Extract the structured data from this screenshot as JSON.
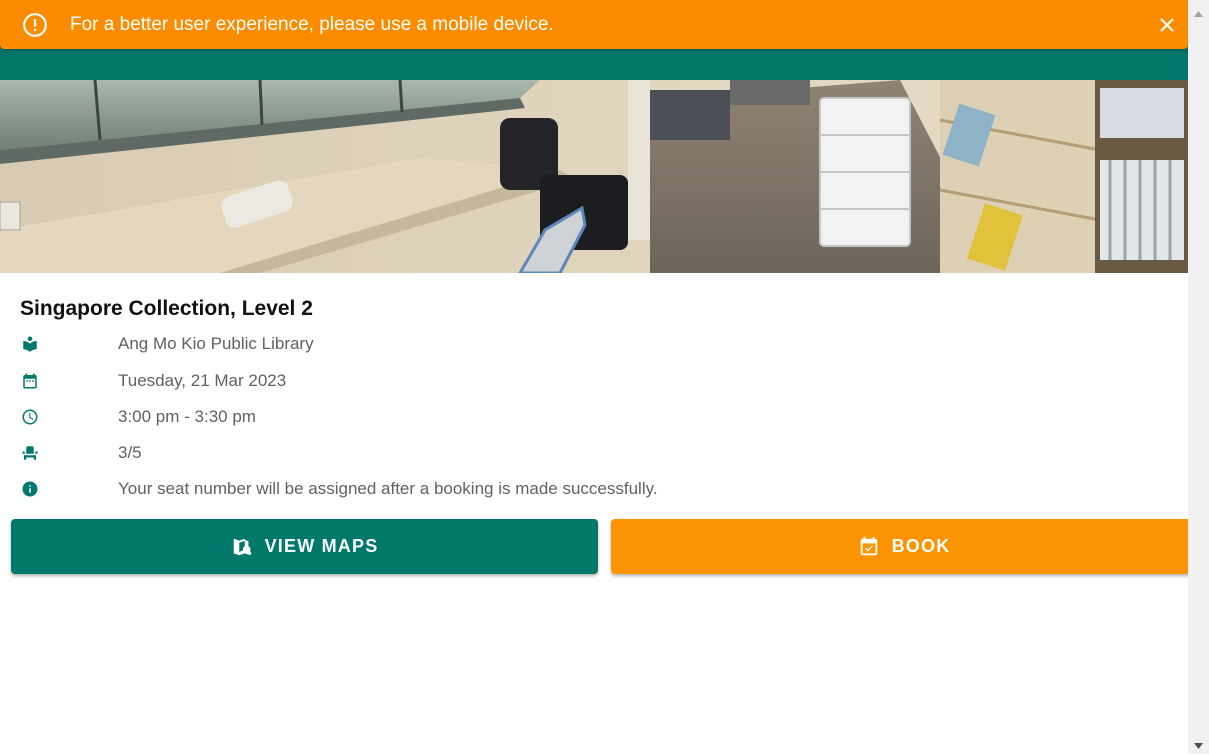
{
  "banner": {
    "message": "For a better user experience, please use a mobile device.",
    "icon": "alert-circle-icon",
    "close_icon": "close-icon",
    "color": "#fb8c00"
  },
  "header": {
    "color": "#00796b"
  },
  "photo": {
    "subject": "library study area"
  },
  "venue": {
    "title": "Singapore Collection, Level 2",
    "library": "Ang Mo Kio Public Library",
    "date": "Tuesday, 21 Mar 2023",
    "time": "3:00 pm - 3:30 pm",
    "seats": "3/5",
    "note": "Your seat number will be assigned after a booking is made successfully."
  },
  "icons": {
    "library": "book-icon",
    "date": "calendar-icon",
    "time": "clock-icon",
    "seats": "seat-icon",
    "note": "info-icon"
  },
  "actions": {
    "view_maps_label": "VIEW MAPS",
    "book_label": "BOOK",
    "view_maps_color": "#00796b",
    "book_color": "#fb9400"
  }
}
